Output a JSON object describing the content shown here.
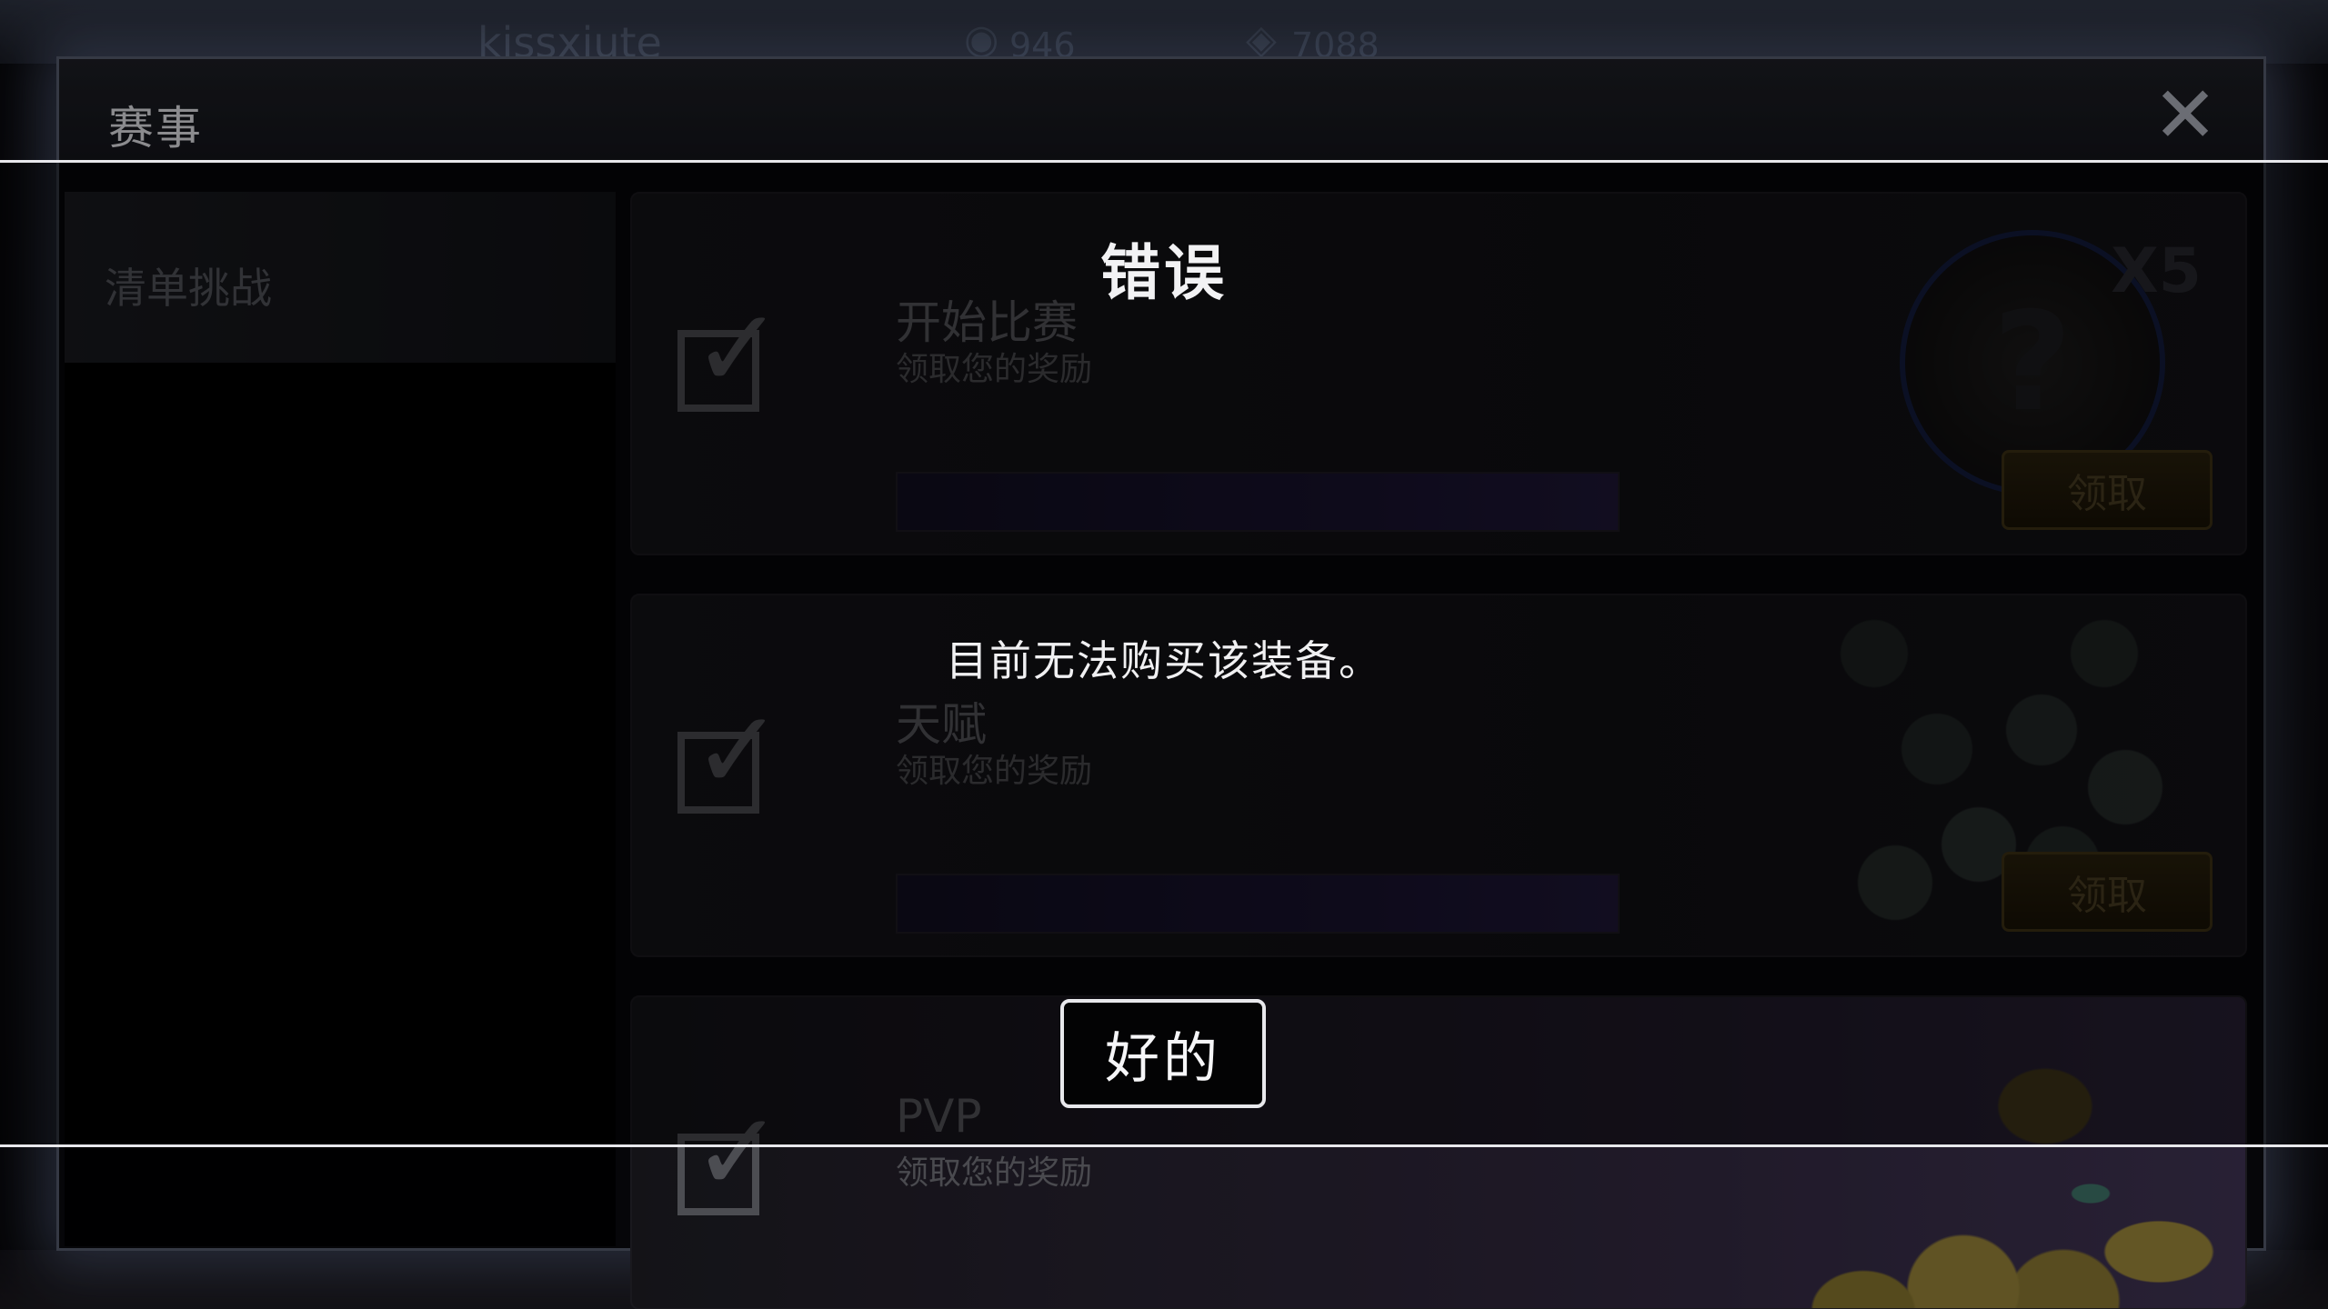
{
  "hud": {
    "player_name": "kissxiute",
    "stat_1": "946",
    "stat_2": "7088"
  },
  "window": {
    "title": "赛事",
    "close_symbol": "✕"
  },
  "sidebar": {
    "items": [
      {
        "label": "清单挑战"
      }
    ]
  },
  "challenges": [
    {
      "title": "开始比赛",
      "subtitle": "领取您的奖励",
      "claim_label": "领取",
      "reward_multiplier": "X5",
      "reward_icon": "mystery-coin",
      "progress": 0.0
    },
    {
      "title": "天赋",
      "subtitle": "领取您的奖励",
      "claim_label": "领取",
      "reward_icon": "silver-coin-pile",
      "progress": 0.0
    },
    {
      "title": "PVP",
      "subtitle": "领取您的奖励",
      "reward_icon": "gold-coin-pile"
    }
  ],
  "dialog": {
    "title": "错误",
    "message": "目前无法购买该装备。",
    "ok_label": "好的"
  },
  "colors": {
    "dialog_border": "#e8e8ec",
    "claim_button": "#3d3014",
    "progress_fill": "#241c44"
  }
}
